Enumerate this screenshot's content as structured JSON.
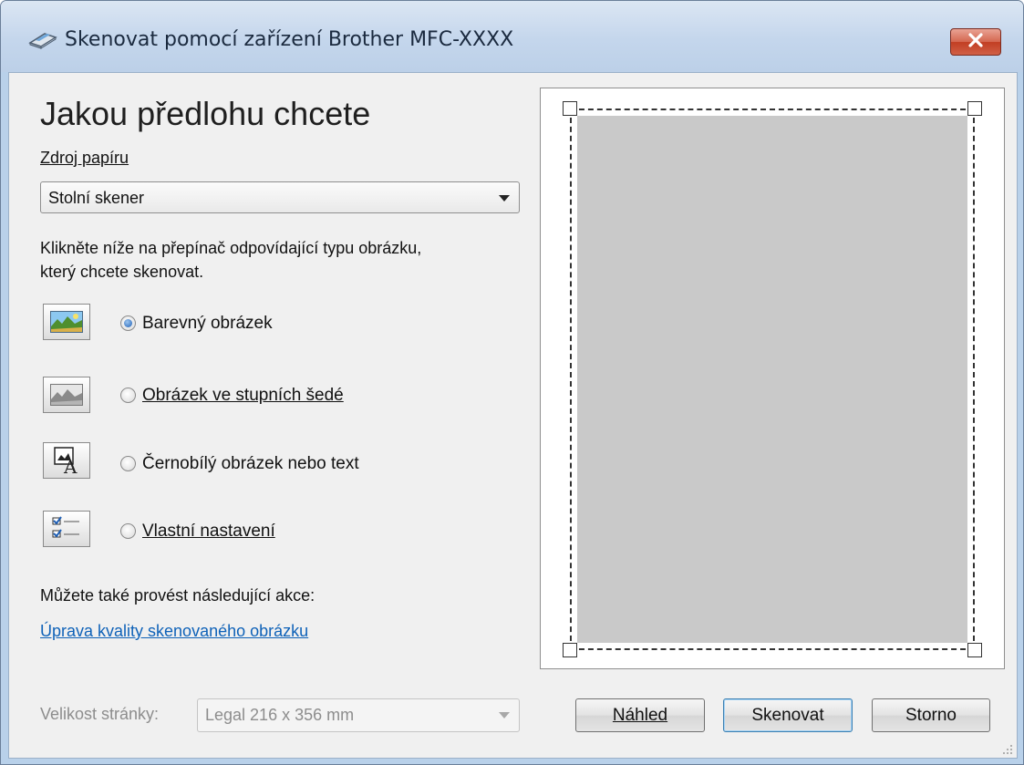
{
  "window": {
    "title": "Skenovat pomocí zařízení Brother MFC-XXXX",
    "title_icon": "scanner-icon",
    "close_icon": "close-icon"
  },
  "form": {
    "heading": "Jakou předlohu chcete",
    "paper_source": {
      "label": "Zdroj papíru",
      "value": "Stolní skener"
    },
    "instruction_line1": "Klikněte níže na přepínač odpovídající typu obrázku,",
    "instruction_line2": "který chcete skenovat.",
    "options": [
      {
        "label": "Barevný obrázek",
        "icon": "color-picture-icon",
        "selected": true
      },
      {
        "label": "Obrázek ve stupních šedé",
        "icon": "grayscale-picture-icon",
        "selected": false
      },
      {
        "label": "Černobílý obrázek nebo text",
        "icon": "black-white-text-icon",
        "selected": false
      },
      {
        "label": "Vlastní nastavení",
        "icon": "custom-settings-icon",
        "selected": false
      }
    ],
    "also_label": "Můžete také provést následující akce:",
    "adjust_link": "Úprava kvality skenovaného obrázku",
    "page_size": {
      "label": "Velikost stránky:",
      "value": "Legal 216 x 356 mm"
    }
  },
  "buttons": {
    "preview": "Náhled",
    "scan": "Skenovat",
    "cancel": "Storno"
  },
  "colors": {
    "link": "#0f62b8",
    "selected_radio": "#1f5fb5",
    "close_button": "#c23e23",
    "preview_area": "#c9c9c9"
  }
}
